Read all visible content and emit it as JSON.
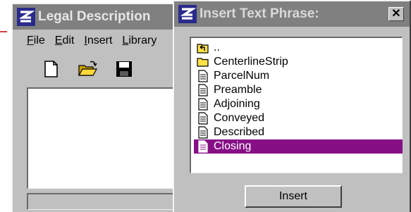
{
  "back_window": {
    "title": "Legal Description",
    "menu": [
      {
        "label": "File",
        "mnemonic": "F",
        "rest": "ile"
      },
      {
        "label": "Edit",
        "mnemonic": "E",
        "rest": "dit"
      },
      {
        "label": "Insert",
        "mnemonic": "I",
        "rest": "nsert"
      },
      {
        "label": "Library",
        "mnemonic": "L",
        "rest": "ibrary"
      }
    ],
    "toolbar": [
      "new-document-icon",
      "open-folder-icon",
      "save-disk-icon"
    ]
  },
  "dialog": {
    "title": "Insert Text Phrase:",
    "close_label": "✕",
    "items": [
      {
        "label": "..",
        "icon": "parent-folder-icon",
        "selected": false
      },
      {
        "label": "CenterlineStrip",
        "icon": "folder-icon",
        "selected": false
      },
      {
        "label": "ParcelNum",
        "icon": "document-icon",
        "selected": false
      },
      {
        "label": "Preamble",
        "icon": "document-icon",
        "selected": false
      },
      {
        "label": "Adjoining",
        "icon": "document-icon",
        "selected": false
      },
      {
        "label": "Conveyed",
        "icon": "document-icon",
        "selected": false
      },
      {
        "label": "Described",
        "icon": "document-icon",
        "selected": false
      },
      {
        "label": "Closing",
        "icon": "document-icon",
        "selected": true
      }
    ],
    "insert_label": "Insert"
  },
  "colors": {
    "face": "#c0c0c0",
    "titlebar": "#808080",
    "selection": "#860f86"
  }
}
